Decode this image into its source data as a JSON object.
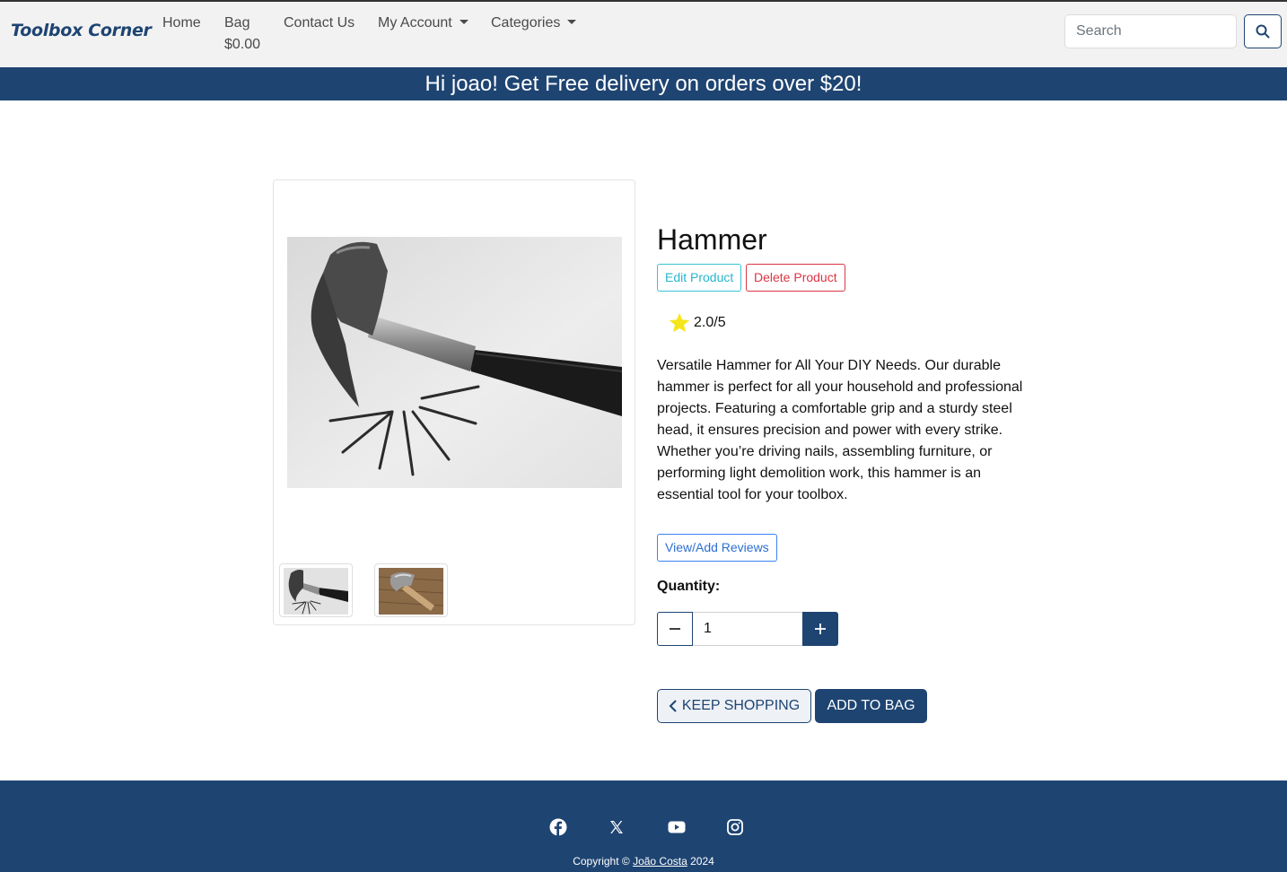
{
  "navbar": {
    "brand": "Toolbox Corner",
    "home": "Home",
    "bag": "Bag",
    "bag_total": "$0.00",
    "contact": "Contact Us",
    "my_account": "My Account",
    "categories": "Categories",
    "search_placeholder": "Search",
    "search_icon": "search-icon"
  },
  "banner": {
    "text": "Hi joao! Get Free delivery on orders over $20!"
  },
  "product": {
    "title": "Hammer",
    "edit_label": "Edit Product",
    "delete_label": "Delete Product",
    "rating": "2.0/5",
    "rating_icon": "star-icon",
    "star_color": "#f5e61c",
    "description": "Versatile Hammer for All Your DIY Needs. Our durable hammer is perfect for all your household and professional projects. Featuring a comfortable grip and a sturdy steel head, it ensures precision and power with every strike. Whether you’re driving nails, assembling furniture, or performing light demolition work, this hammer is an essential tool for your toolbox.",
    "reviews_label": "View/Add Reviews",
    "quantity_label": "Quantity:",
    "quantity_value": "1",
    "keep_shopping_label": "KEEP SHOPPING",
    "add_to_bag_label": "ADD TO BAG"
  },
  "footer": {
    "social": [
      "facebook-icon",
      "x-icon",
      "youtube-icon",
      "instagram-icon"
    ],
    "copyright_prefix": "Copyright © ",
    "copyright_name": "João Costa",
    "copyright_year": " 2024"
  },
  "colors": {
    "brand": "#1e4472",
    "nav_bg": "#f2f2f2",
    "edit": "#38c3d6",
    "delete": "#dc3545",
    "reviews": "#3b82f6"
  }
}
